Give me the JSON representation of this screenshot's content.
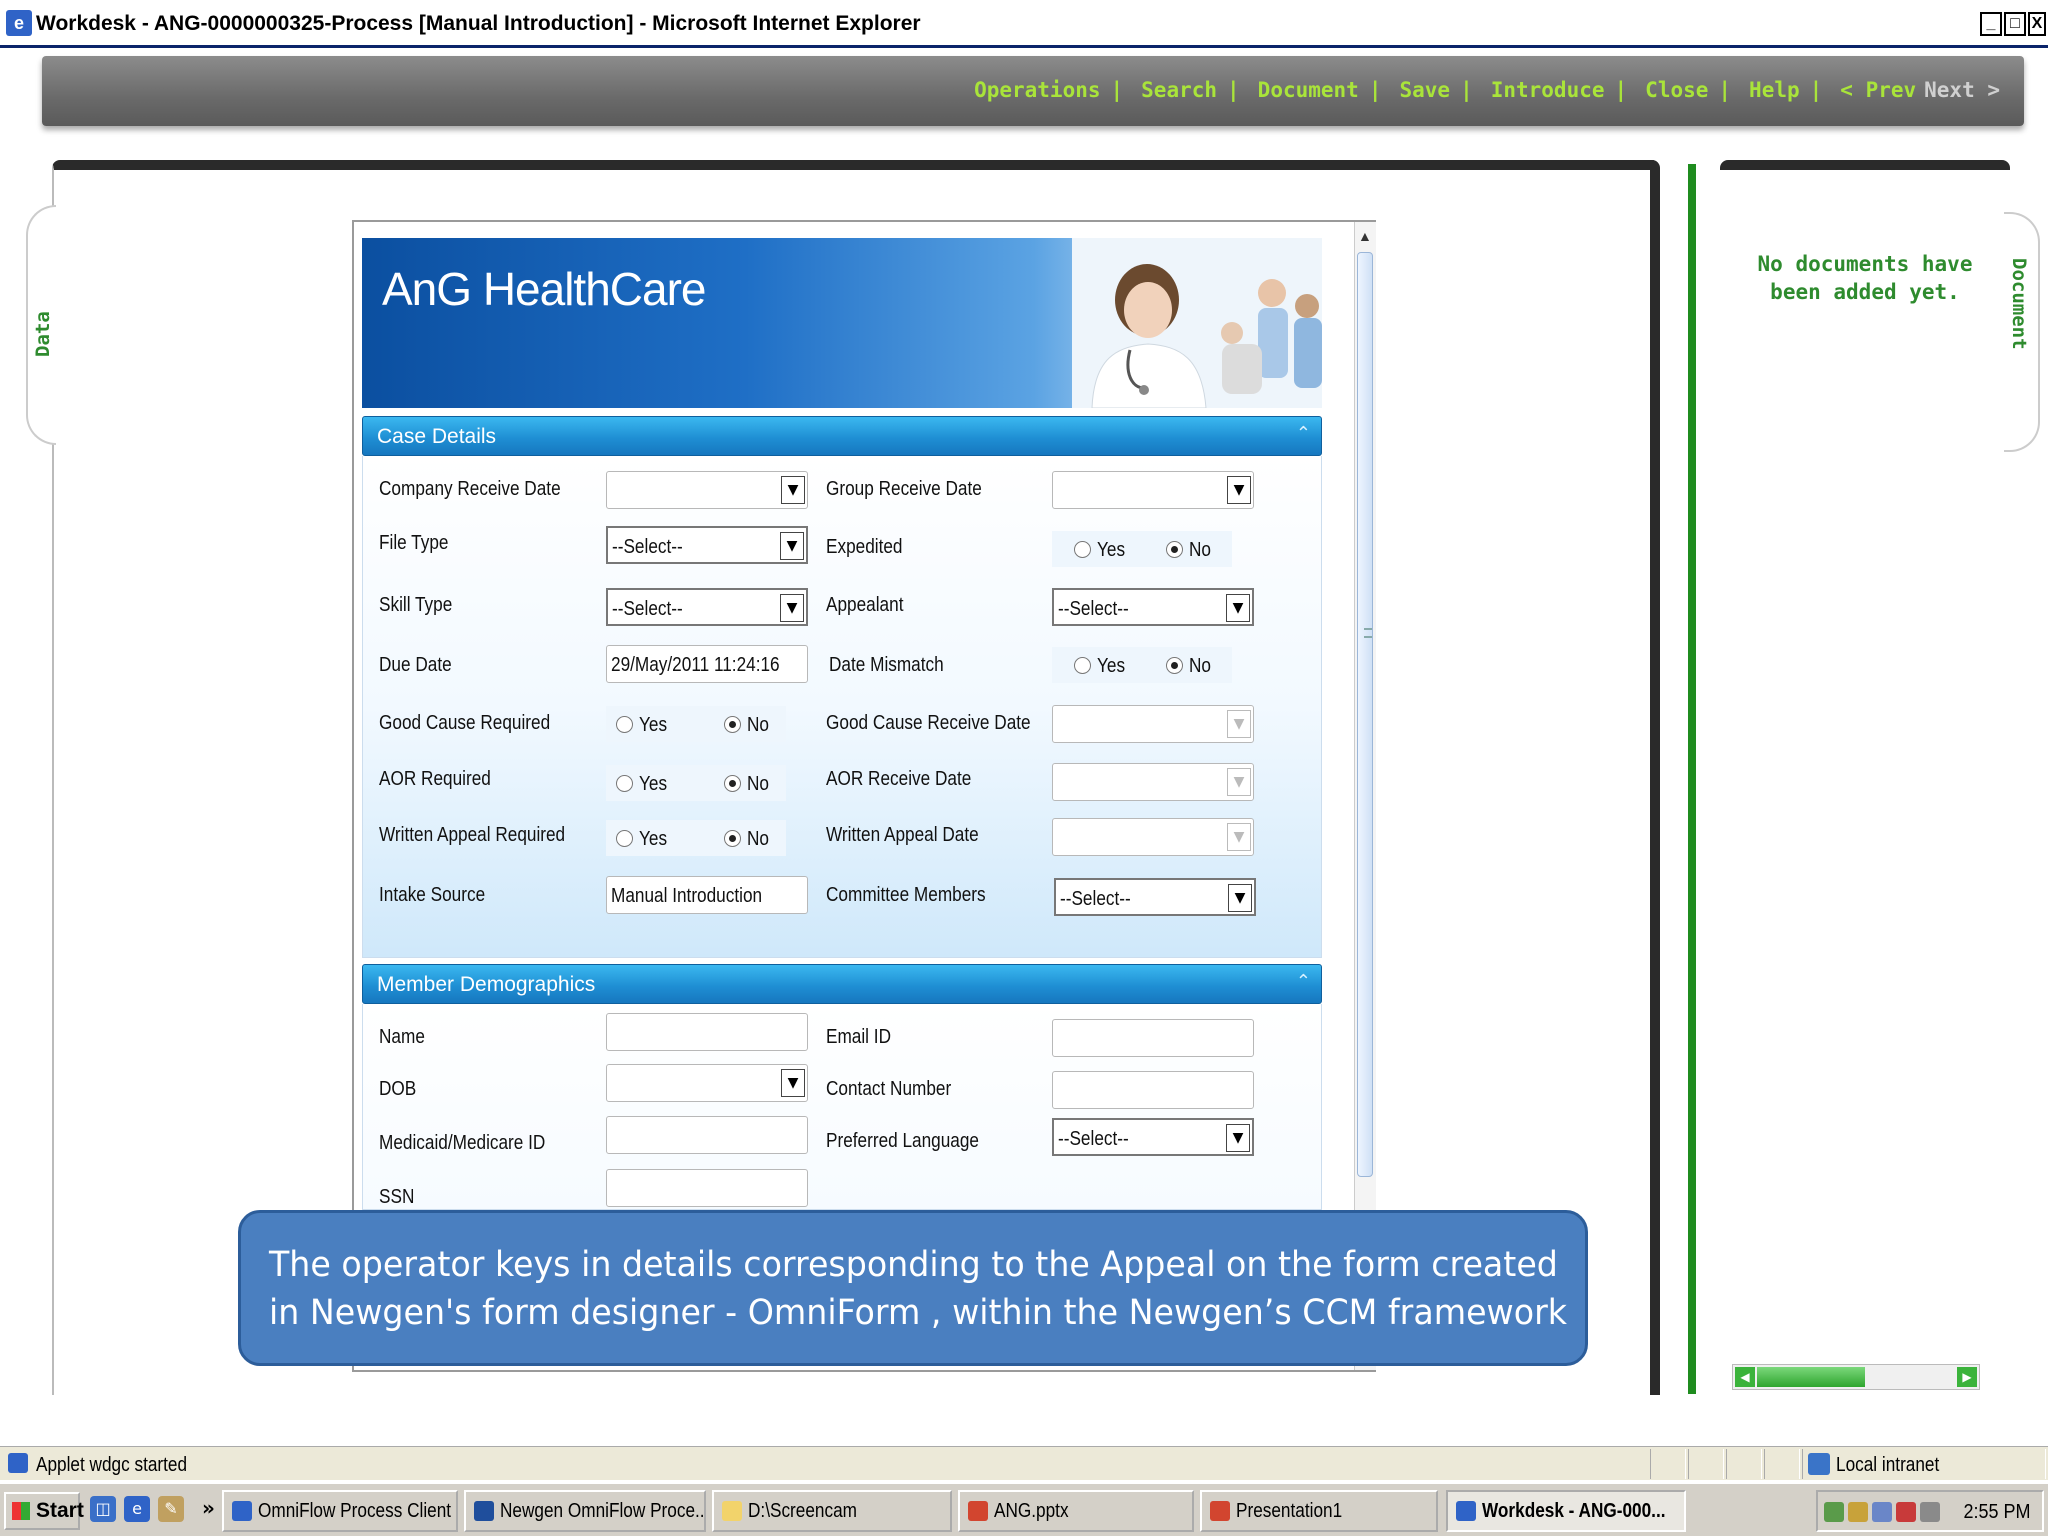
{
  "window": {
    "title": "Workdesk - ANG-0000000325-Process [Manual Introduction] - Microsoft Internet Explorer",
    "min": "_",
    "max": "□",
    "close": "X"
  },
  "toolbar": {
    "items": [
      "Operations",
      "Search",
      "Document",
      "Save",
      "Introduce",
      "Close",
      "Help"
    ],
    "separator": "|",
    "prev": "< Prev",
    "next": "Next >"
  },
  "side_tabs": {
    "left": "Data",
    "right": "Document"
  },
  "documents_panel": {
    "message": "No documents have been added yet."
  },
  "banner": {
    "brand": "AnG HealthCare"
  },
  "case_details": {
    "header": "Case Details",
    "company_receive_date": {
      "label": "Company Receive Date",
      "value": ""
    },
    "group_receive_date": {
      "label": "Group Receive Date",
      "value": ""
    },
    "file_type": {
      "label": "File Type",
      "value": "--Select--"
    },
    "expedited": {
      "label": "Expedited",
      "yes": "Yes",
      "no": "No",
      "selected": "No"
    },
    "skill_type": {
      "label": "Skill Type",
      "value": "--Select--"
    },
    "appealant": {
      "label": "Appealant",
      "value": "--Select--"
    },
    "due_date": {
      "label": "Due Date",
      "value": "29/May/2011 11:24:16"
    },
    "date_mismatch": {
      "label": "Date Mismatch",
      "yes": "Yes",
      "no": "No",
      "selected": "No"
    },
    "good_cause_required": {
      "label": "Good Cause Required",
      "yes": "Yes",
      "no": "No",
      "selected": "No"
    },
    "good_cause_receive_date": {
      "label": "Good Cause Receive Date",
      "value": ""
    },
    "aor_required": {
      "label": "AOR Required",
      "yes": "Yes",
      "no": "No",
      "selected": "No"
    },
    "aor_receive_date": {
      "label": "AOR Receive Date",
      "value": ""
    },
    "written_appeal_required": {
      "label": "Written Appeal Required",
      "yes": "Yes",
      "no": "No",
      "selected": "No"
    },
    "written_appeal_date": {
      "label": "Written Appeal Date",
      "value": ""
    },
    "intake_source": {
      "label": "Intake Source",
      "value": "Manual Introduction"
    },
    "committee_members": {
      "label": "Committee Members",
      "value": "--Select--"
    }
  },
  "member_demographics": {
    "header": "Member Demographics",
    "name": {
      "label": "Name",
      "value": ""
    },
    "email_id": {
      "label": "Email ID",
      "value": ""
    },
    "dob": {
      "label": "DOB",
      "value": ""
    },
    "contact_number": {
      "label": "Contact Number",
      "value": ""
    },
    "medicaid_id": {
      "label": "Medicaid/Medicare ID",
      "value": ""
    },
    "preferred_language": {
      "label": "Preferred Language",
      "value": "--Select--"
    },
    "ssn": {
      "label": "SSN",
      "value": ""
    }
  },
  "caption": {
    "line1": "The operator keys in details  corresponding to the Appeal on the form created",
    "line2": "in  Newgen's  form designer - OmniForm , within the  Newgen’s CCM framework"
  },
  "statusbar": {
    "text": "Applet wdgc started",
    "zone": "Local intranet"
  },
  "taskbar": {
    "start": "Start",
    "more": "»",
    "tasks": [
      {
        "label": "OmniFlow Process Client ..."
      },
      {
        "label": "Newgen OmniFlow Proce..."
      },
      {
        "label": "D:\\Screencam"
      },
      {
        "label": "ANG.pptx"
      },
      {
        "label": "Presentation1"
      },
      {
        "label": "Workdesk - ANG-000..."
      }
    ],
    "clock": "2:55 PM"
  },
  "colors": {
    "toolbar_link": "#a9e43a",
    "panel_green": "#2e8b2e",
    "section_blue": "#1f8fd4",
    "caption_bg": "#4a7fc0"
  },
  "icons": {
    "dropdown": "▼",
    "collapse": "⌃",
    "scroll_up": "▲"
  }
}
